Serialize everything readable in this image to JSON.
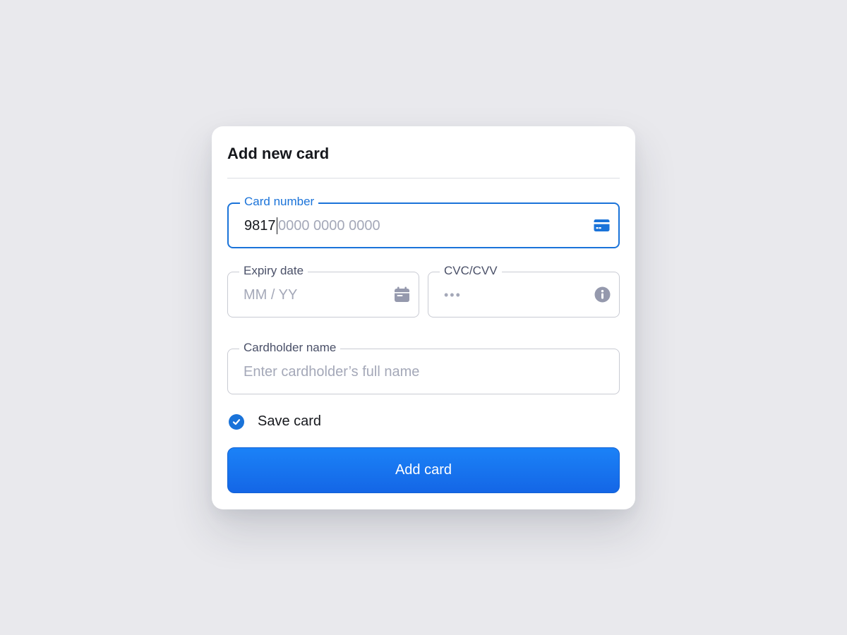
{
  "modal": {
    "title": "Add new card"
  },
  "card_number": {
    "label": "Card number",
    "value": "9817",
    "placeholder_rest": "0000 0000 0000",
    "icon": "credit-card-icon"
  },
  "expiry": {
    "label": "Expiry date",
    "placeholder": "MM / YY",
    "icon": "calendar-icon"
  },
  "cvc": {
    "label": "CVC/CVV",
    "placeholder": "•••",
    "icon": "info-icon"
  },
  "cardholder": {
    "label": "Cardholder name",
    "placeholder": "Enter cardholder’s full name"
  },
  "save_card": {
    "label": "Save card",
    "checked": true
  },
  "submit": {
    "label": "Add card"
  },
  "colors": {
    "accent": "#1a73d9",
    "button_top": "#1b82f7",
    "button_bottom": "#1466e6",
    "background": "#e9e9ed",
    "border": "#c9cbd3",
    "placeholder": "#a4a8b8"
  }
}
